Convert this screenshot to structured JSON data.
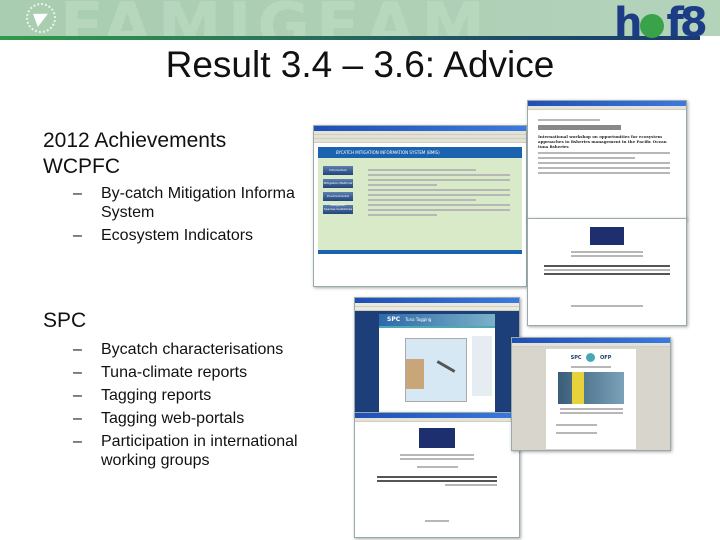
{
  "header": {
    "watermark_text": "FAMIGEAM",
    "brand_logo_text": [
      "h",
      "f8"
    ]
  },
  "slide": {
    "title": "Result 3.4 – 3.6: Advice",
    "sections": [
      {
        "heading_lines": [
          "2012 Achievements",
          "WCPFC"
        ],
        "bullets": [
          "By-catch Mitigation Informa",
          "System",
          "Ecosystem Indicators"
        ]
      },
      {
        "heading_lines": [
          "SPC"
        ],
        "bullets": [
          "Bycatch characterisations",
          "Tuna-climate reports",
          "Tagging reports",
          "Tagging web-portals",
          "Participation in international",
          "working groups"
        ]
      }
    ],
    "dash": "–"
  },
  "screenshots": {
    "wcpfc_portal": {
      "banner": "BYCATCH MITIGATION INFORMATION SYSTEM (BMIS)",
      "menu": [
        "Introduction",
        "Mitigation Methods",
        "Environmental Mitigation",
        "Species Guidelines"
      ],
      "colors": {
        "banner": "#1b62b0",
        "body": "#d9eac8"
      }
    },
    "workshop_paper": {
      "heading": "International workshop on opportunities for ecosystem approaches to fisheries management in the Pacific Ocean tuna fisheries"
    },
    "spc_portal": {
      "brand": "SPC",
      "subtitle": "Tuna Tagging"
    },
    "spc_report": {
      "brand_left": "SPC",
      "brand_right": "OFP"
    }
  }
}
